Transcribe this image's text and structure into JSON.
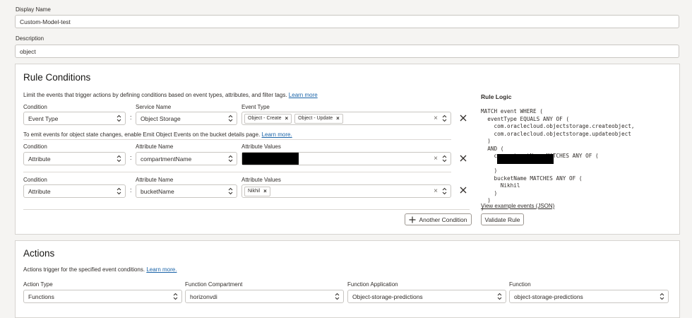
{
  "display_name": {
    "label": "Display Name",
    "value": "Custom-Model-test"
  },
  "description": {
    "label": "Description",
    "value": "object"
  },
  "rule_conditions": {
    "title": "Rule Conditions",
    "intro": "Limit the events that trigger actions by defining conditions based on event types, attributes, and filter tags.",
    "intro_link": "Learn more",
    "rows": [
      {
        "condition_label": "Condition",
        "condition": "Event Type",
        "name_label": "Service Name",
        "name": "Object Storage",
        "values_label": "Event Type",
        "tags": [
          "Object - Create",
          "Object - Update"
        ]
      },
      {
        "condition_label": "Condition",
        "condition": "Attribute",
        "name_label": "Attribute Name",
        "name": "compartmentName",
        "values_label": "Attribute Values",
        "tags": []
      },
      {
        "condition_label": "Condition",
        "condition": "Attribute",
        "name_label": "Attribute Name",
        "name": "bucketName",
        "values_label": "Attribute Values",
        "tags": [
          "Nikhil"
        ]
      }
    ],
    "note": "To emit events for object state changes, enable Emit Object Events on the bucket details page.",
    "note_link": "Learn more.",
    "another_condition_label": "Another Condition",
    "rule_logic": {
      "title": "Rule Logic",
      "code_lines": [
        "MATCH event WHERE (",
        "  eventType EQUALS ANY OF (",
        "    com.oraclecloud.objectstorage.createobject,",
        "    com.oraclecloud.objectstorage.updateobject",
        "  )",
        "  AND (",
        "    compartmentName MATCHES ANY OF (",
        "",
        "    )",
        "    bucketName MATCHES ANY OF (",
        "      Nikhil",
        "    )",
        "  )",
        ")"
      ],
      "view_link": "View example events (JSON)",
      "validate_label": "Validate Rule"
    }
  },
  "actions": {
    "title": "Actions",
    "intro": "Actions trigger for the specified event conditions.",
    "intro_link": "Learn more.",
    "fields": [
      {
        "label": "Action Type",
        "value": "Functions"
      },
      {
        "label": "Function Compartment",
        "value": "horizonvdi"
      },
      {
        "label": "Function Application",
        "value": "Object-storage-predictions"
      },
      {
        "label": "Function",
        "value": "object-storage-predictions"
      }
    ]
  },
  "colors": {
    "link": "#1b64a8",
    "panel_border": "#d7d4d0",
    "background": "#f5f4f2"
  }
}
